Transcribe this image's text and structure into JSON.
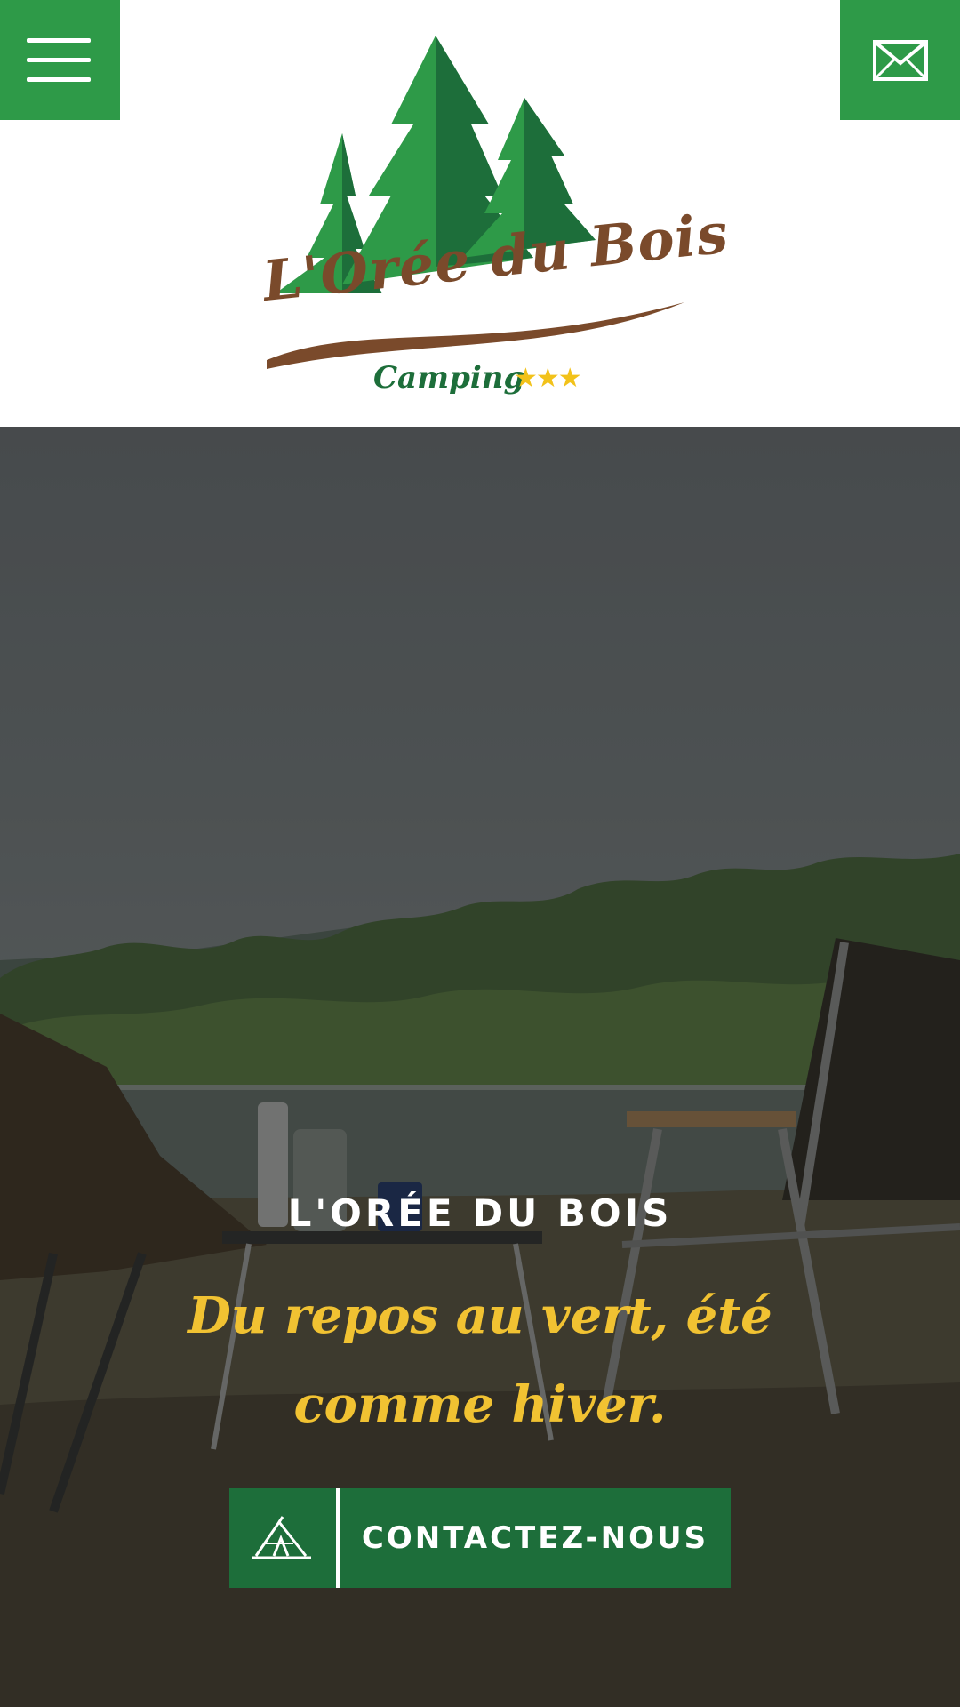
{
  "header": {
    "menu_icon": "hamburger-menu-icon",
    "mail_icon": "envelope-icon",
    "logo": {
      "title": "L'Orée du Bois",
      "subtitle": "Camping",
      "stars": "★★★",
      "star_count": 3
    }
  },
  "hero": {
    "title": "L'ORÉE DU BOIS",
    "tagline": "Du repos au vert, été comme hiver.",
    "cta": {
      "label": "CONTACTEZ-NOUS",
      "icon": "tent-icon"
    }
  },
  "colors": {
    "brand_green": "#2e9a48",
    "dark_green": "#1d6e3a",
    "tagline_yellow": "#f1c232",
    "logo_brown": "#7a4a2b",
    "star_yellow": "#f2c21a"
  }
}
